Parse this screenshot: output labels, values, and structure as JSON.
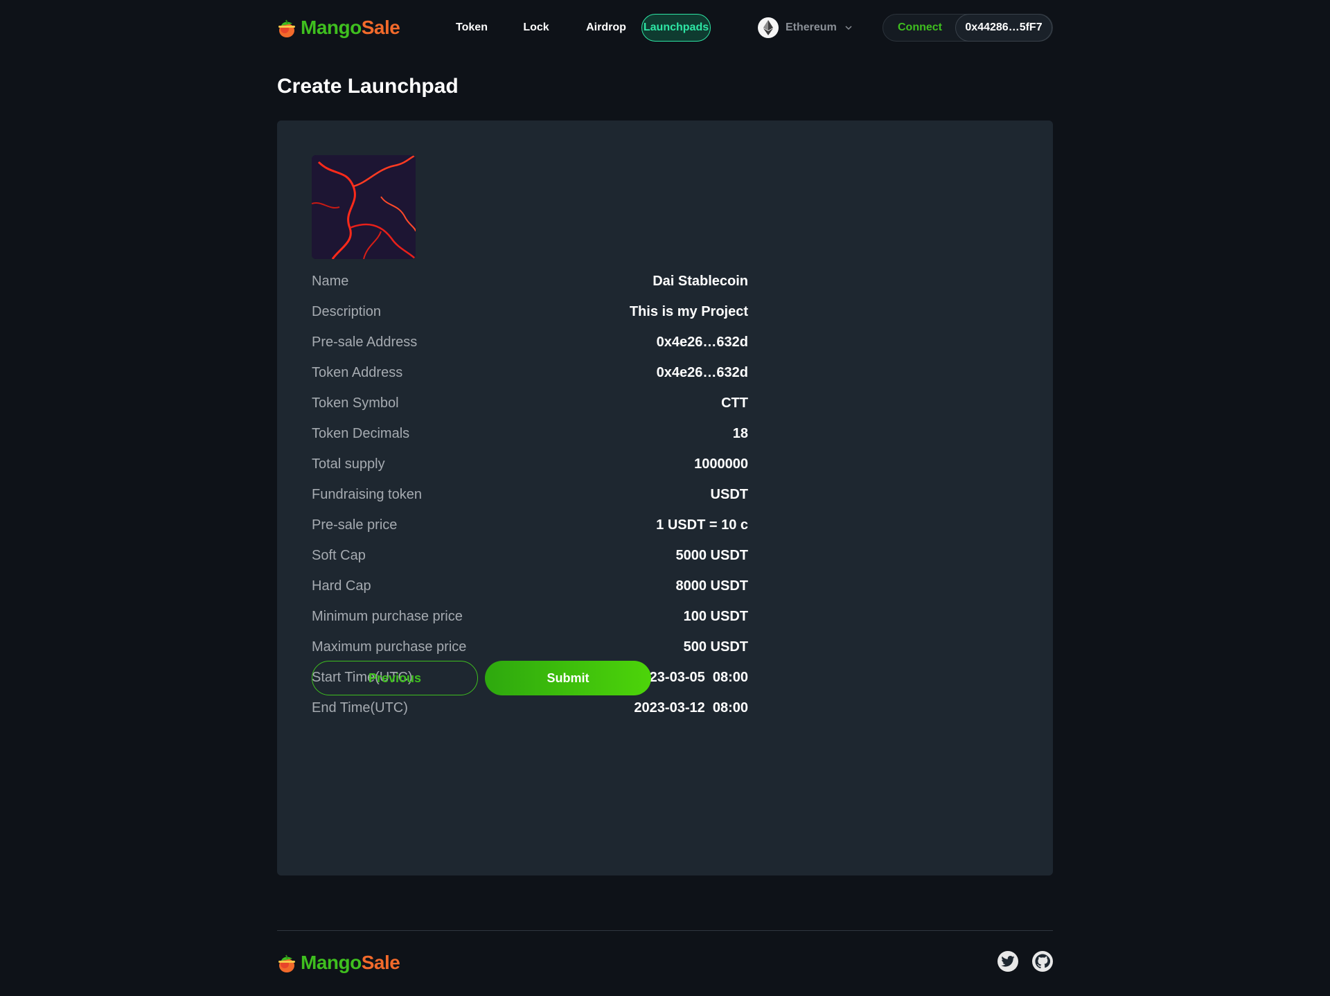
{
  "brand": {
    "name_part1": "Mango",
    "name_part2": "Sale"
  },
  "nav": {
    "items": [
      "Token",
      "Lock",
      "Airdrop",
      "Launchpads"
    ],
    "active": "Launchpads"
  },
  "network": {
    "label": "Ethereum"
  },
  "wallet": {
    "connect_label": "Connect",
    "address": "0x44286…5fF7"
  },
  "page": {
    "title": "Create Launchpad"
  },
  "details": [
    {
      "label": "Name",
      "value": "Dai Stablecoin"
    },
    {
      "label": "Description",
      "value": "This is my Project"
    },
    {
      "label": "Pre-sale Address",
      "value": "0x4e26…632d"
    },
    {
      "label": "Token Address",
      "value": "0x4e26…632d"
    },
    {
      "label": "Token Symbol",
      "value": "CTT"
    },
    {
      "label": "Token Decimals",
      "value": "18"
    },
    {
      "label": "Total supply",
      "value": "1000000"
    },
    {
      "label": "Fundraising token",
      "value": "USDT"
    },
    {
      "label": "Pre-sale price",
      "value": "1 USDT = 10 c"
    },
    {
      "label": "Soft Cap",
      "value": "5000 USDT"
    },
    {
      "label": "Hard Cap",
      "value": "8000 USDT"
    },
    {
      "label": "Minimum purchase price",
      "value": "100 USDT"
    },
    {
      "label": "Maximum purchase price",
      "value": "500 USDT"
    },
    {
      "label": "Start Time(UTC)",
      "value": "2023-03-05  08:00"
    },
    {
      "label": "End Time(UTC)",
      "value": "2023-03-12  08:00"
    }
  ],
  "buttons": {
    "previous": "Previous",
    "submit": "Submit"
  },
  "colors": {
    "accent_green": "#3fbf1f",
    "brand_orange": "#f26a2b",
    "active_teal": "#2ee6a5",
    "card_bg": "#1e2730",
    "page_bg": "#0e1218"
  },
  "icons": {
    "network": "ethereum-icon",
    "social": [
      "twitter-icon",
      "github-icon"
    ]
  }
}
